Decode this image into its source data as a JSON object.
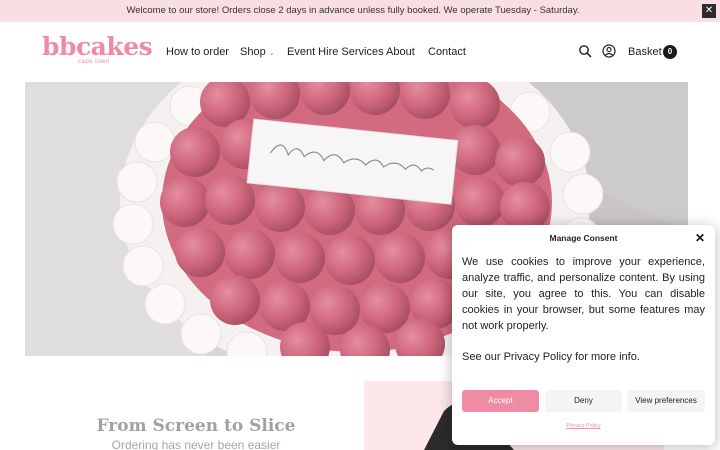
{
  "announcement": {
    "text": "Welcome to our store! Orders close 2 days in advance unless fully booked. We operate Tuesday - Saturday.",
    "close_label": "✕"
  },
  "brand": {
    "name": "bbcakes",
    "tagline": "cape town"
  },
  "nav": {
    "items": [
      {
        "label": "How to order"
      },
      {
        "label": "Shop",
        "caret": "⌄"
      },
      {
        "label": "Event Hire Services"
      },
      {
        "label": "About"
      },
      {
        "label": "Contact"
      }
    ]
  },
  "header_icons": {
    "search": "search-icon",
    "account": "account-icon"
  },
  "basket": {
    "label": "Basket",
    "count": "0"
  },
  "hero": {
    "card_text": "Happy Birthday Fatima"
  },
  "section": {
    "title": "From Screen to Slice",
    "subtitle": "Ordering has never been easier"
  },
  "consent": {
    "title": "Manage Consent",
    "body": "We use cookies to improve your experience, analyze traffic, and personalize content. By using our site, you agree to this. You can disable cookies in your browser, but some features may not work properly.",
    "more": "See our Privacy Policy for more info.",
    "accept_label": "Accept",
    "deny_label": "Deny",
    "preferences_label": "View preferences",
    "privacy_link": "Privacy Policy"
  },
  "colors": {
    "brand_pink": "#ef8ca4",
    "announce_bg": "#f9dfe3",
    "dark": "#1a1a1a"
  }
}
